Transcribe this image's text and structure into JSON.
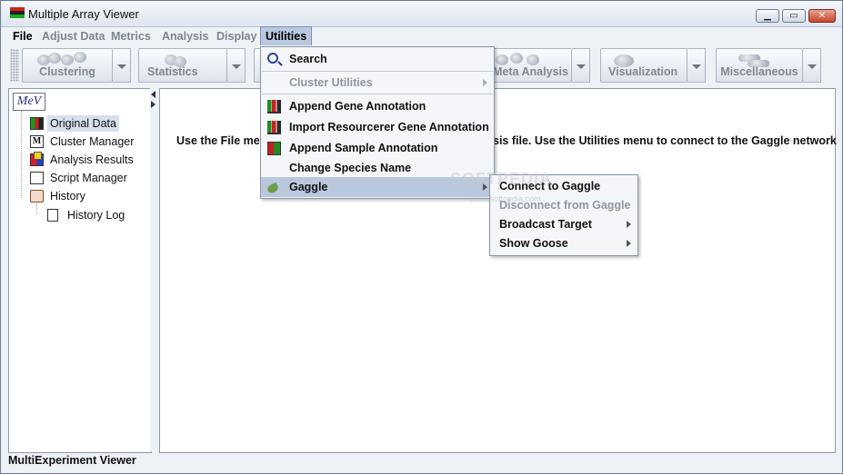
{
  "window": {
    "title": "Multiple Array Viewer"
  },
  "menubar": {
    "items": [
      {
        "label": "File",
        "enabled": true
      },
      {
        "label": "Adjust Data",
        "enabled": false
      },
      {
        "label": "Metrics",
        "enabled": false
      },
      {
        "label": "Analysis",
        "enabled": false
      },
      {
        "label": "Display",
        "enabled": false
      },
      {
        "label": "Utilities",
        "enabled": true,
        "active": true
      }
    ]
  },
  "toolbar": {
    "buttons": [
      {
        "label": "Clustering"
      },
      {
        "label": "Statistics"
      },
      {
        "label": "Meta Analysis"
      },
      {
        "label": "Visualization"
      },
      {
        "label": "Miscellaneous"
      }
    ]
  },
  "tree": {
    "logo": "MeV",
    "items": [
      {
        "label": "Original Data",
        "icon": "data-matrix-icon",
        "selected": true
      },
      {
        "label": "Cluster Manager",
        "icon": "cluster-manager-icon"
      },
      {
        "label": "Analysis Results",
        "icon": "analysis-results-icon"
      },
      {
        "label": "Script Manager",
        "icon": "script-manager-icon"
      },
      {
        "label": "History",
        "icon": "history-scroll-icon"
      },
      {
        "label": "History Log",
        "icon": "document-icon"
      }
    ]
  },
  "main": {
    "message_left": "Use the File men",
    "message_right": "sis file. Use the Utilities menu to connect to the Gaggle network"
  },
  "statusbar": {
    "text": "MultiExperiment Viewer"
  },
  "utilities_menu": {
    "items": [
      {
        "label": "Search",
        "icon": "search-icon",
        "enabled": true
      },
      {
        "label": "Cluster Utilities",
        "enabled": false,
        "submenu": true
      },
      {
        "label": "Append Gene Annotation",
        "icon": "annotation-bars-icon",
        "enabled": true
      },
      {
        "label": "Import Resourcerer Gene Annotation",
        "icon": "annotation-bars-icon",
        "enabled": true
      },
      {
        "label": "Append Sample Annotation",
        "icon": "sample-annotation-icon",
        "enabled": true
      },
      {
        "label": "Change Species Name",
        "enabled": true
      },
      {
        "label": "Gaggle",
        "icon": "gaggle-goose-icon",
        "enabled": true,
        "submenu": true,
        "highlighted": true
      }
    ]
  },
  "gaggle_menu": {
    "items": [
      {
        "label": "Connect to Gaggle",
        "enabled": true
      },
      {
        "label": "Disconnect from Gaggle",
        "enabled": false
      },
      {
        "label": "Broadcast Target",
        "enabled": true,
        "submenu": true
      },
      {
        "label": "Show Goose",
        "enabled": true,
        "submenu": true
      }
    ]
  },
  "watermark": {
    "text": "SOFTPEDIA",
    "subtext": "www.softpedia.com"
  },
  "colors": {
    "menu_highlight": "#b9c8dd",
    "disabled_text": "#8f96a0",
    "window_bg": "#eef1f6"
  }
}
